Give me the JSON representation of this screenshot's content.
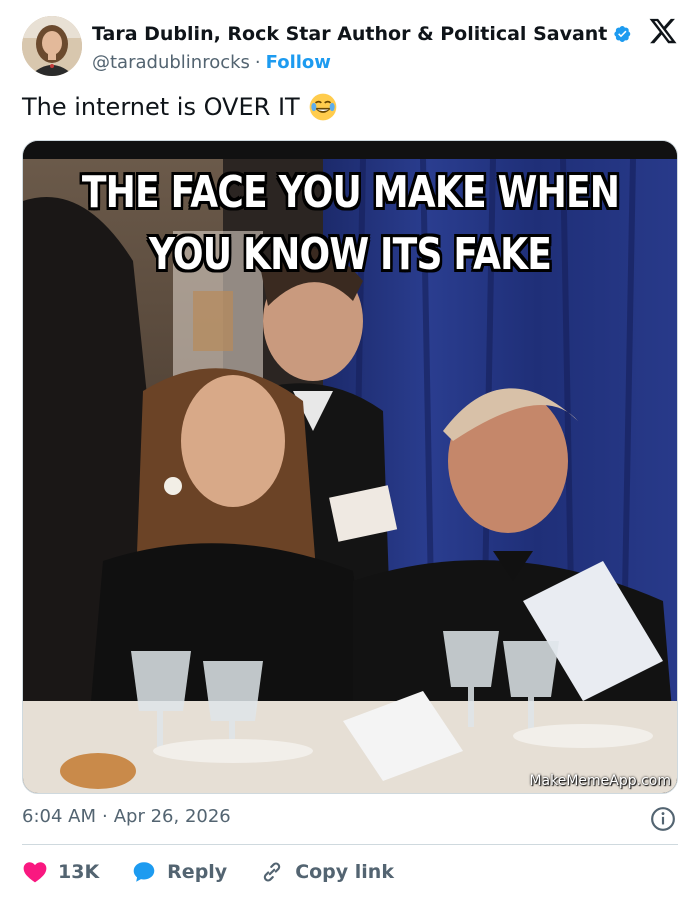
{
  "author": {
    "display_name": "Tara Dublin, Rock Star Author & Political Savant",
    "handle": "@taradublinrocks",
    "separator": "·",
    "follow_label": "Follow",
    "verified_color": "#1d9bf0"
  },
  "tweet": {
    "text": "The internet is OVER IT",
    "emoji": "face-with-tears-of-joy"
  },
  "media": {
    "meme_top_text": "THE FACE YOU MAKE WHEN",
    "meme_bottom_text": "YOU KNOW ITS FAKE",
    "watermark": "MakeMemeApp.com"
  },
  "meta": {
    "time": "6:04 AM",
    "separator": "·",
    "date": "Apr 26, 2026"
  },
  "actions": {
    "like_count": "13K",
    "reply_label": "Reply",
    "copy_link_label": "Copy link"
  },
  "colors": {
    "accent": "#1d9bf0",
    "like": "#f91880",
    "muted": "#536471",
    "text": "#0f1419"
  },
  "icons": [
    "x-logo-icon",
    "verified-badge-icon",
    "laughing-emoji-icon",
    "info-icon",
    "heart-icon",
    "reply-bubble-icon",
    "link-icon"
  ]
}
